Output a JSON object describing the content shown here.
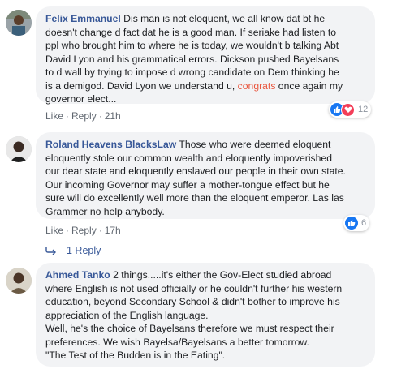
{
  "comments": [
    {
      "author": "Felix Emmanuel",
      "lines": [
        " Dis man is not eloquent, we all know dat bt he",
        "doesn't change d fact dat he is a good man. If seriake had listen to",
        "ppl who brought him to where he is today, we wouldn't b talking Abt",
        "David Lyon and his grammatical errors. Dickson pushed Bayelsans",
        "to d wall by trying to impose d wrong candidate on Dem thinking he",
        "is a demigod. David Lyon we understand u, "
      ],
      "highlight": "congrats",
      "line6_tail": " once again my",
      "last_line": "governor elect...",
      "like": "Like",
      "reply": "Reply",
      "time": "21h",
      "reaction_count": "12",
      "reaction_icons": [
        "like-icon",
        "love-icon"
      ]
    },
    {
      "author": "Roland Heavens BlacksLaw",
      "lines": [
        " Those who were deemed eloquent",
        "eloquently stole our common wealth and eloquently impoverished",
        "our dear state and eloquently enslaved our people in their own state.",
        "Our incoming Governor may suffer a mother-tongue effect but he",
        "sure will do excellently well more than the eloquent emperor. Las las",
        "Grammer no help anybody."
      ],
      "like": "Like",
      "reply": "Reply",
      "time": "17h",
      "reaction_count": "6",
      "reaction_icons": [
        "like-icon"
      ],
      "replies_label": "1 Reply"
    },
    {
      "author": "Ahmed Tanko",
      "lines": [
        " 2 things.....it's either the Gov-Elect studied abroad",
        "where English is not used officially or he couldn't further his western",
        "education, beyond Secondary School & didn't bother to improve his",
        "appreciation of the English language.",
        "Well, he's the choice of Bayelsans therefore we must respect their",
        "preferences. We wish Bayelsa/Bayelsans a better tomorrow.",
        "\"The Test of the Budden is in the Eating\"."
      ]
    }
  ],
  "colors": {
    "author": "#385898",
    "bubble": "#f2f3f5",
    "like_blue": "#1877f2",
    "love_red": "#f33e58",
    "highlight": "#e9573f"
  }
}
